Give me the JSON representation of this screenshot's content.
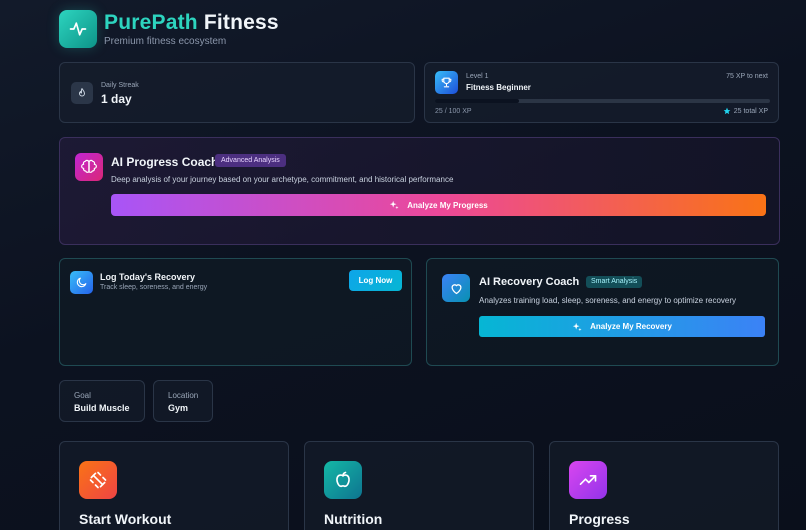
{
  "header": {
    "brand_first": "PurePath",
    "brand_second": " Fitness",
    "subtitle": "Premium fitness ecosystem",
    "logo_icon": "pulse-icon"
  },
  "streak": {
    "label": "Daily Streak",
    "value": "1 day",
    "icon": "flame-icon"
  },
  "level": {
    "level_label": "Level 1",
    "name": "Fitness Beginner",
    "xp_to_next": "75 XP to next",
    "xp_current": "25 / 100 XP",
    "xp_total": "25 total XP",
    "progress_fraction": 0.25,
    "icon": "trophy-icon"
  },
  "ai_progress_coach": {
    "title": "AI Progress Coach",
    "badge": "Advanced Analysis",
    "description": "Deep analysis of your journey based on your archetype, commitment, and historical performance",
    "button_label": "Analyze My Progress",
    "icon": "brain-icon"
  },
  "recovery_log": {
    "title": "Log Today's Recovery",
    "subtitle": "Track sleep, soreness, and energy",
    "button_label": "Log Now",
    "icon": "moon-icon"
  },
  "ai_recovery_coach": {
    "title": "AI Recovery Coach",
    "badge": "Smart Analysis",
    "description": "Analyzes training load, sleep, soreness, and energy to optimize recovery",
    "button_label": "Analyze My Recovery",
    "icon": "heart-icon"
  },
  "profile": {
    "goal_label": "Goal",
    "goal_value": "Build Muscle",
    "location_label": "Location",
    "location_value": "Gym"
  },
  "features": [
    {
      "label": "Start Workout",
      "icon": "dumbbell-icon",
      "color": "#f97316"
    },
    {
      "label": "Nutrition",
      "icon": "apple-icon",
      "color": "#14b8a6"
    },
    {
      "label": "Progress",
      "icon": "trending-up-icon",
      "color": "#d946ef"
    }
  ],
  "colors": {
    "accent": "#2dd4bf",
    "background": "#0c1220"
  }
}
